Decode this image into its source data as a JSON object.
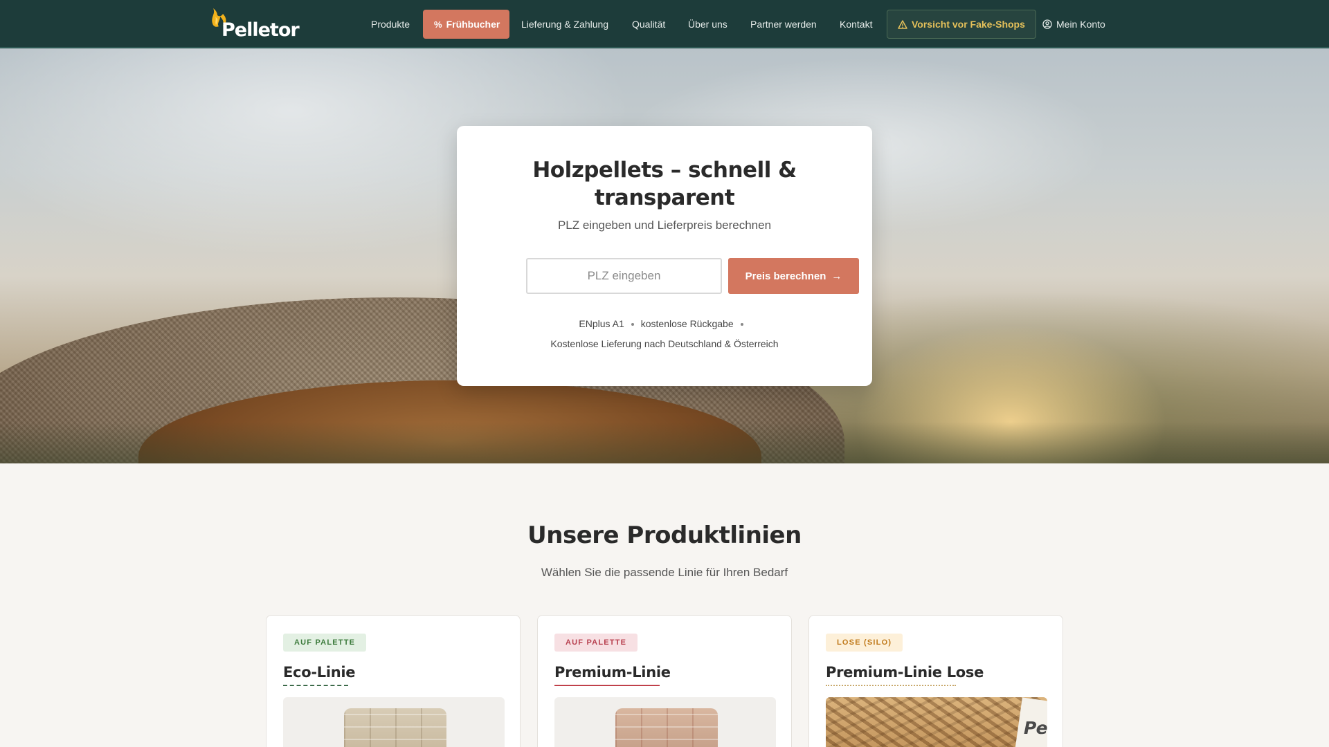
{
  "header": {
    "logo_text": "Pelletor",
    "nav": {
      "produkte": "Produkte",
      "fruehbucher": "Frühbucher",
      "lieferung": "Lieferung & Zahlung",
      "qualitaet": "Qualität",
      "ueber_uns": "Über uns",
      "partner": "Partner werden",
      "kontakt": "Kontakt",
      "fake_shops": "Vorsicht vor Fake-Shops",
      "konto": "Mein Konto"
    }
  },
  "hero": {
    "title": "Holzpellets – schnell & transparent",
    "subtitle": "PLZ eingeben und Lieferpreis berechnen",
    "plz_placeholder": "PLZ eingeben",
    "plz_value": "",
    "button_label": "Preis berechnen",
    "badges": [
      "ENplus A1",
      "kostenlose Rückgabe"
    ],
    "delivery_note": "Kostenlose Lieferung nach Deutschland & Österreich"
  },
  "products": {
    "title": "Unsere Produktlinien",
    "subtitle": "Wählen Sie die passende Linie für Ihren Bedarf",
    "items": [
      {
        "badge": "AUF PALETTE",
        "name": "Eco-Linie",
        "badge_color": "#3b7a3b"
      },
      {
        "badge": "AUF PALETTE",
        "name": "Premium-Linie",
        "badge_color": "#b8404f"
      },
      {
        "badge": "LOSE (SILO)",
        "name": "Premium-Linie Lose",
        "badge_color": "#c07a1b",
        "image_text": "Pe"
      }
    ]
  },
  "colors": {
    "header_bg": "#1d3c3a",
    "accent": "#d3775f",
    "warning": "#e6c15a"
  },
  "icons": {
    "logo": "flame-logo-icon",
    "promo": "percent-icon",
    "warning": "warning-triangle-icon",
    "account": "user-circle-icon",
    "button": "arrow-right-icon"
  }
}
